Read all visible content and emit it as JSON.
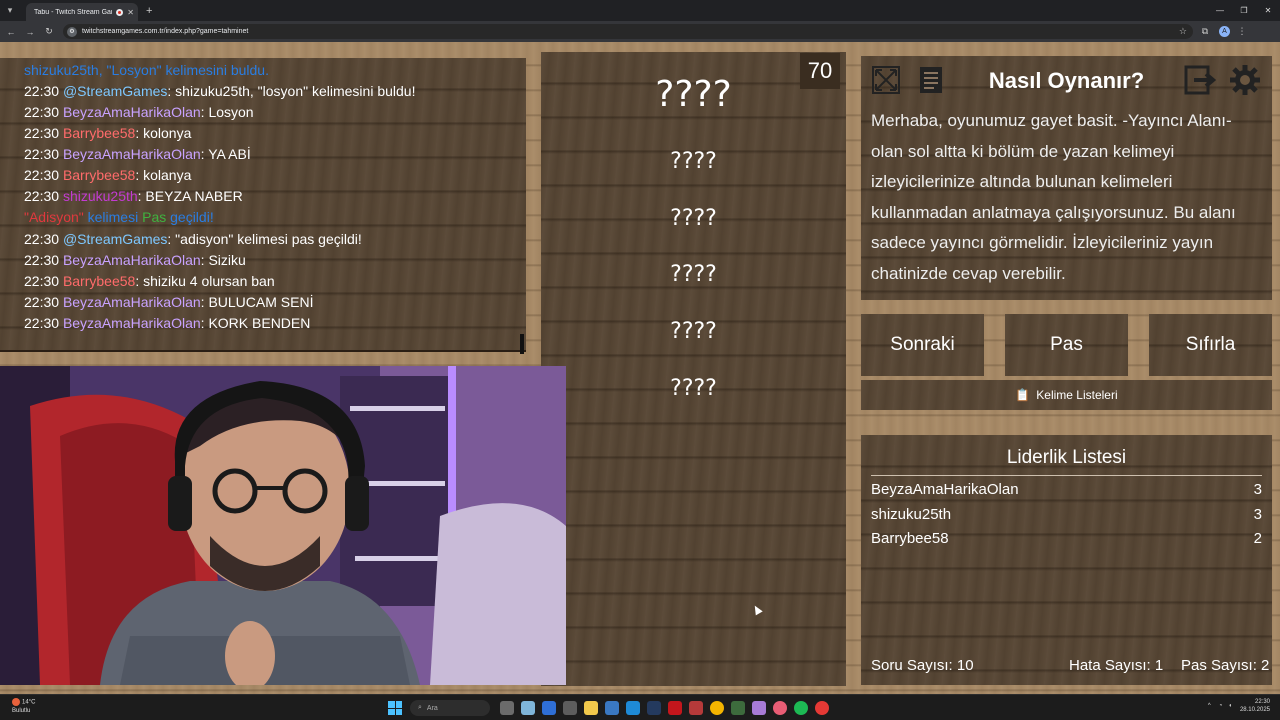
{
  "browser": {
    "tab_title": "Tabu - Twitch Stream Game",
    "url": "twitchstreamgames.com.tr/index.php?game=tahminet"
  },
  "chat": {
    "lines": [
      {
        "kind": "system_found",
        "user": "shizuku25th",
        "text": ", \"Losyon\" kelimesini buldu."
      },
      {
        "time": "22:30",
        "user": "@StreamGames",
        "ucolor": "u-sg",
        "msg": ": shizuku25th, \"losyon\" kelimesini buldu!"
      },
      {
        "time": "22:30",
        "user": "BeyzaAmaHarikaOlan",
        "ucolor": "u-bey",
        "msg": ": Losyon"
      },
      {
        "time": "22:30",
        "user": "Barrybee58",
        "ucolor": "u-bar",
        "msg": ": kolonya"
      },
      {
        "time": "22:30",
        "user": "BeyzaAmaHarikaOlan",
        "ucolor": "u-bey",
        "msg": ": YA ABİ"
      },
      {
        "time": "22:30",
        "user": "Barrybee58",
        "ucolor": "u-bar",
        "msg": ": kolanya"
      },
      {
        "time": "22:30",
        "user": "shizuku25th",
        "ucolor": "u-shi",
        "msg": ": BEYZA NABER"
      },
      {
        "kind": "system_pass",
        "word": "\"Adisyon\"",
        "mid": " kelimesi ",
        "pas": "Pas",
        "end": " geçildi!"
      },
      {
        "time": "22:30",
        "user": "@StreamGames",
        "ucolor": "u-sg",
        "msg": ": \"adisyon\" kelimesi pas geçildi!"
      },
      {
        "time": "22:30",
        "user": "BeyzaAmaHarikaOlan",
        "ucolor": "u-bey",
        "msg": ": Siziku"
      },
      {
        "time": "22:30",
        "user": "Barrybee58",
        "ucolor": "u-bar",
        "msg": ": shiziku 4 olursan ban"
      },
      {
        "time": "22:30",
        "user": "BeyzaAmaHarikaOlan",
        "ucolor": "u-bey",
        "msg": ": BULUCAM SENİ"
      },
      {
        "time": "22:30",
        "user": "BeyzaAmaHarikaOlan",
        "ucolor": "u-bey",
        "msg": ": KORK BENDEN"
      }
    ]
  },
  "game": {
    "timer": "70",
    "target_word": "????",
    "forbidden_words": [
      "????",
      "????",
      "????",
      "????",
      "????"
    ]
  },
  "info": {
    "title": "Nasıl Oynanır?",
    "text": "Merhaba, oyunumuz gayet basit. -Yayıncı Alanı- olan sol altta ki bölüm de yazan kelimeyi izleyicilerinize altında bulunan kelimeleri kullanmadan anlatmaya çalışıyorsunuz. Bu alanı sadece yayıncı görmelidir. İzleyicileriniz yayın chatinizde cevap verebilir."
  },
  "actions": {
    "next": "Sonraki",
    "pass": "Pas",
    "reset": "Sıfırla",
    "word_lists": "Kelime Listeleri"
  },
  "leaderboard": {
    "title": "Liderlik Listesi",
    "rows": [
      {
        "name": "BeyzaAmaHarikaOlan",
        "score": "3"
      },
      {
        "name": "shizuku25th",
        "score": "3"
      },
      {
        "name": "Barrybee58",
        "score": "2"
      }
    ],
    "stats": {
      "question_count": "Soru Sayısı: 10",
      "error_count": "Hata Sayısı: 1",
      "pass_count": "Pas Sayısı: 2"
    }
  },
  "taskbar": {
    "weather_temp": "14°C",
    "weather_desc": "Bulutlu",
    "search_placeholder": "Ara",
    "time": "22:30",
    "date": "28.10.2025"
  }
}
